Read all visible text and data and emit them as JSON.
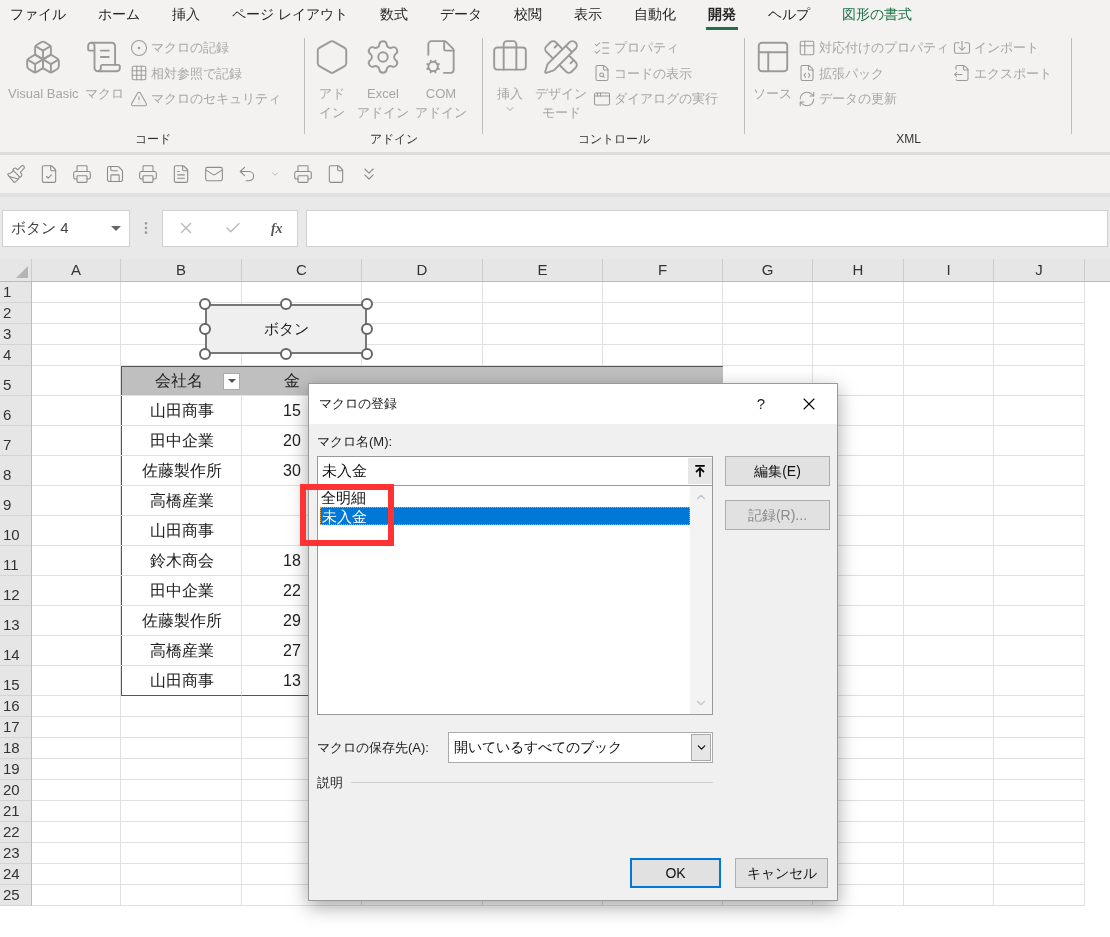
{
  "menu_tabs": [
    {
      "label": "ファイル",
      "kind": "normal",
      "selected": false
    },
    {
      "label": "ホーム",
      "kind": "normal",
      "selected": false
    },
    {
      "label": "挿入",
      "kind": "normal",
      "selected": false
    },
    {
      "label": "ページ レイアウト",
      "kind": "normal",
      "selected": false
    },
    {
      "label": "数式",
      "kind": "normal",
      "selected": false
    },
    {
      "label": "データ",
      "kind": "normal",
      "selected": false
    },
    {
      "label": "校閲",
      "kind": "normal",
      "selected": false
    },
    {
      "label": "表示",
      "kind": "normal",
      "selected": false
    },
    {
      "label": "自動化",
      "kind": "normal",
      "selected": false
    },
    {
      "label": "開発",
      "kind": "normal",
      "selected": true
    },
    {
      "label": "ヘルプ",
      "kind": "normal",
      "selected": false
    },
    {
      "label": "図形の書式",
      "kind": "contextual",
      "selected": false
    }
  ],
  "ribbon_groups": [
    {
      "label": "コード",
      "large_buttons": [
        {
          "lines": [
            "Visual Basic"
          ],
          "disabled": true,
          "dropdown": false
        },
        {
          "lines": [
            "マクロ"
          ],
          "disabled": true,
          "dropdown": false
        }
      ],
      "small_columns": [
        [
          {
            "label": "マクロの記録",
            "disabled": true
          },
          {
            "label": "相対参照で記録",
            "disabled": true
          },
          {
            "label": "マクロのセキュリティ",
            "disabled": true
          }
        ]
      ]
    },
    {
      "label": "アドイン",
      "large_buttons": [
        {
          "lines": [
            "アド",
            "イン"
          ],
          "disabled": true,
          "dropdown": false
        },
        {
          "lines": [
            "Excel",
            "アドイン"
          ],
          "disabled": true,
          "dropdown": false
        },
        {
          "lines": [
            "COM",
            "アドイン"
          ],
          "disabled": true,
          "dropdown": false
        }
      ]
    },
    {
      "label": "コントロール",
      "large_buttons": [
        {
          "lines": [
            "挿入"
          ],
          "disabled": true,
          "dropdown": true
        },
        {
          "lines": [
            "デザイン",
            "モード"
          ],
          "disabled": true,
          "dropdown": false
        }
      ],
      "small_columns": [
        [
          {
            "label": "プロパティ",
            "disabled": true
          },
          {
            "label": "コードの表示",
            "disabled": true
          },
          {
            "label": "ダイアログの実行",
            "disabled": true
          }
        ]
      ]
    },
    {
      "label": "XML",
      "large_buttons": [
        {
          "lines": [
            "ソース"
          ],
          "disabled": true,
          "dropdown": false
        }
      ],
      "small_columns": [
        [
          {
            "label": "対応付けのプロパティ",
            "disabled": true
          },
          {
            "label": "拡張パック",
            "disabled": true
          },
          {
            "label": "データの更新",
            "disabled": true
          }
        ],
        [
          {
            "label": "インポート",
            "disabled": true
          },
          {
            "label": "エクスポート",
            "disabled": true
          }
        ]
      ]
    }
  ],
  "name_box": {
    "value": "ボタン 4"
  },
  "formula_bar": {
    "function_button": "fx"
  },
  "sheet": {
    "columns": [
      "A",
      "B",
      "C",
      "D",
      "E",
      "F",
      "G",
      "H",
      "I",
      "J"
    ],
    "rows": [
      "1",
      "2",
      "3",
      "4",
      "5",
      "6",
      "7",
      "8",
      "9",
      "10",
      "11",
      "12",
      "13",
      "14",
      "15",
      "16",
      "17",
      "18",
      "19",
      "20",
      "21",
      "22",
      "23",
      "24",
      "25"
    ]
  },
  "shape": {
    "label": "ボタン",
    "selected": true
  },
  "table": {
    "headers": [
      {
        "label": "会社名",
        "filter": true
      },
      {
        "label": "金",
        "filter": false
      }
    ],
    "rows": [
      {
        "company": "山田商事",
        "amount": "15"
      },
      {
        "company": "田中企業",
        "amount": "20"
      },
      {
        "company": "佐藤製作所",
        "amount": "30"
      },
      {
        "company": "高橋産業"
      },
      {
        "company": "山田商事"
      },
      {
        "company": "鈴木商会",
        "amount": "18"
      },
      {
        "company": "田中企業",
        "amount": "22"
      },
      {
        "company": "佐藤製作所",
        "amount": "29"
      },
      {
        "company": "高橋産業",
        "amount": "27"
      },
      {
        "company": "山田商事",
        "amount": "13"
      }
    ]
  },
  "dialog": {
    "title": "マクロの登録",
    "help": "?",
    "name_label": "マクロ名(M):",
    "name_value": "未入金",
    "macros": [
      {
        "label": "全明細",
        "selected": false
      },
      {
        "label": "未入金",
        "selected": true
      }
    ],
    "side_buttons": [
      {
        "label": "編集(E)",
        "disabled": false
      },
      {
        "label": "記録(R)...",
        "disabled": true
      }
    ],
    "store_label": "マクロの保存先(A):",
    "store_value": "開いているすべてのブック",
    "description_label": "説明",
    "footer_buttons": [
      {
        "label": "OK",
        "default": true
      },
      {
        "label": "キャンセル",
        "default": false
      }
    ]
  }
}
